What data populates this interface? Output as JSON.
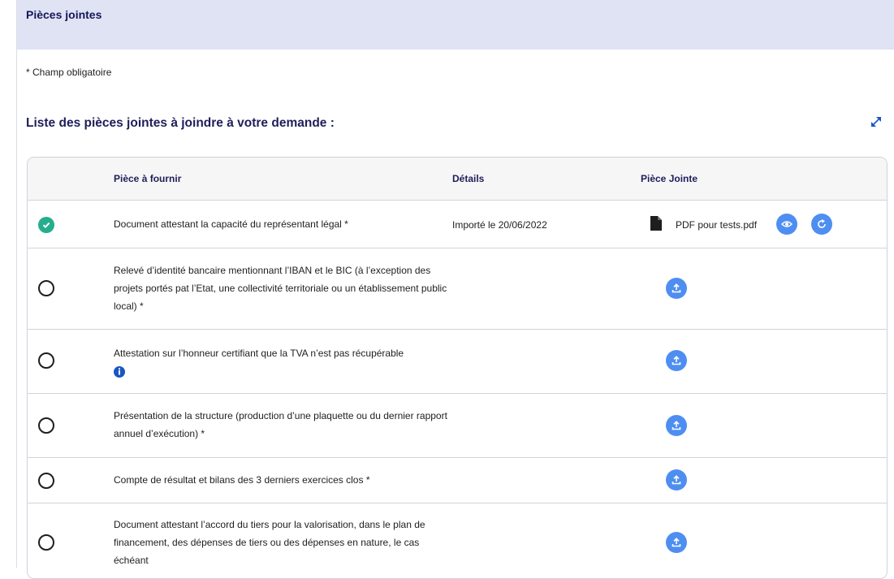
{
  "section": {
    "title": "Pièces jointes"
  },
  "required_note": "* Champ obligatoire",
  "list_title": "Liste des pièces jointes à joindre à votre demande :",
  "columns": {
    "piece": "Pièce à fournir",
    "details": "Détails",
    "attachment": "Pièce Jointe"
  },
  "rows": [
    {
      "status": "uploaded",
      "piece": "Document attestant la capacité du représentant légal *",
      "details": "Importé le 20/06/2022",
      "file_name": "PDF pour tests.pdf",
      "actions": [
        "eye-icon",
        "refresh-icon"
      ]
    },
    {
      "status": "pending",
      "piece": "Relevé d’identité bancaire mentionnant l’IBAN et le BIC (à l’exception des projets portés pat l’Etat, une collectivité territoriale ou un établissement public local) *",
      "actions": [
        "upload-icon"
      ]
    },
    {
      "status": "pending",
      "piece": "Attestation sur l’honneur certifiant que la TVA n’est pas récupérable",
      "has_info_icon": true,
      "actions": [
        "upload-icon"
      ]
    },
    {
      "status": "pending",
      "piece": "Présentation de la structure (production d’une plaquette ou du dernier rapport annuel d’exécution) *",
      "actions": [
        "upload-icon"
      ]
    },
    {
      "status": "pending",
      "piece": "Compte de résultat et bilans des 3 derniers exercices clos *",
      "actions": [
        "upload-icon"
      ]
    },
    {
      "status": "pending",
      "piece": "Document attestant l’accord du tiers pour la valorisation, dans le plan de financement, des dépenses de tiers ou des dépenses en nature, le cas échéant",
      "actions": [
        "upload-icon"
      ]
    }
  ],
  "colors": {
    "header_bg": "#dfe3f4",
    "navy": "#1e1e5a",
    "success": "#26ad8d",
    "action_blue": "#4e8ef1",
    "info_blue": "#1a56c4"
  }
}
